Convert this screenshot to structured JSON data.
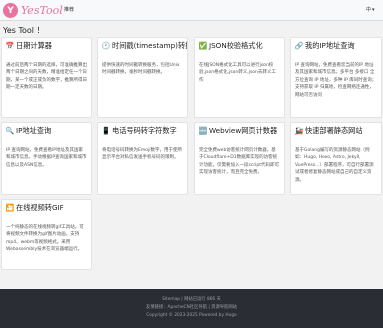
{
  "navbar": {
    "brand_logo": "Y",
    "brand_name": "YesTool",
    "nav_link": "推荐",
    "lang_label": "中",
    "lang_caret": "▾"
  },
  "page": {
    "title": "Yes Tool ！"
  },
  "cards": [
    {
      "icon": "📅",
      "title": "日期计算器",
      "desc": "通过前后两个日期的选择，可准确推算出两个日期之间的天数，精准给定任一个日期，某一个或正或负的数字，推算所得日期一定天数的日期。"
    },
    {
      "icon": "🕐",
      "title": "时间戳(timestamp)转换",
      "desc": "提供快速的时间戳转换服务，包括Unix时间戳转换，毫秒时间戳转换。"
    },
    {
      "icon": "✅",
      "title": "JSON校验格式化",
      "desc": "在线JSON格式化工具可以进行json校验,json格式化,json转义,json去转义工作"
    },
    {
      "icon": "🔗",
      "title": "我的IP地址查询",
      "desc": "IP 查询网站，免费查看您当前的IP 地址及其国家和城市信息。多平台 多接口 全方位查询 IP 地址，多种 IP 库同时查询；支持获取 IP 归属地，检查网络连通性，网站可否访问"
    },
    {
      "icon": "🔍",
      "title": "IP地址查询",
      "desc": "IP 查询网站，免费查看IP地址及其国家和城市信息。手动根据IP查询国家和城市信息以及ASN信息。"
    },
    {
      "icon": "📱",
      "title": "电话号码转字符数字",
      "desc": "将电话号码转换为Emoji数字，用于使所显示平台对私信发送手机号码的限制。"
    },
    {
      "icon": "🆕",
      "title": "Webview网页计数器",
      "desc": "完全免费web访客统计网页计数器，基于Cloudflare+D1数据库实现的访客统计功能，仅需要加入一段script代码即可实现访客统计，而且完全免费。"
    },
    {
      "icon": "🚂",
      "title": "快速部署静态网站",
      "desc": "基于Golang编写的资源静态网站（例如：Hugo, Hexo, Astro, Jekyll, VuePress...）部署程序，可自行部署测试或者修复静态网站或自己的自定义资源。"
    },
    {
      "icon": "🎦",
      "title": "在线视频转GIF",
      "desc": "一个纯静态的在线视频转gif工具站。可将视频文件转换为gif图片动画，支持mp4、webm等视频格式。采用Webassembly技术在浏览器端运行。"
    }
  ],
  "footer": {
    "line1": "Sitemap | 网站已运行 866 天",
    "line2": "友情链接：ApacheCN社区导航 | 资源导航网站",
    "line3": "Copyright © 2023-2025 Powered by Hugo"
  }
}
